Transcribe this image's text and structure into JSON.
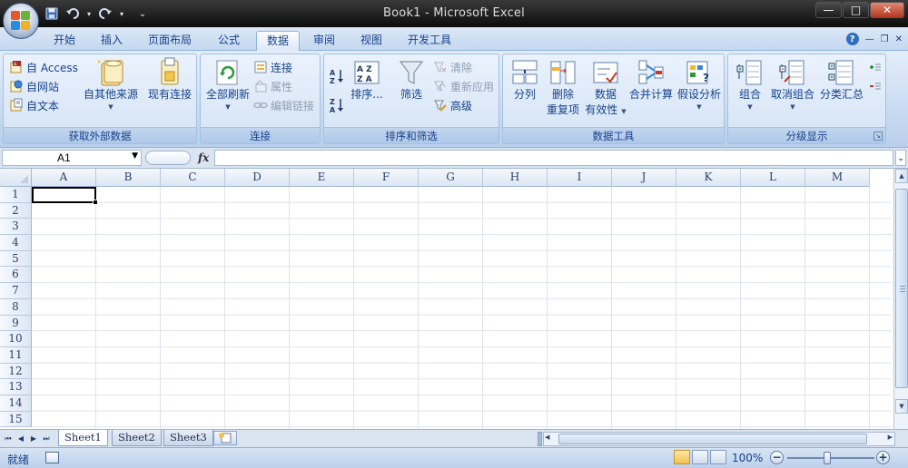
{
  "window": {
    "title": "Book1 - Microsoft Excel",
    "controls": {
      "minimize": "—",
      "maximize": "□",
      "close": "✕"
    }
  },
  "quick_access": [
    "save-icon",
    "undo-icon",
    "redo-icon",
    "customize-icon"
  ],
  "ribbon_tabs": [
    "开始",
    "插入",
    "页面布局",
    "公式",
    "数据",
    "审阅",
    "视图",
    "开发工具"
  ],
  "active_tab": "数据",
  "groups": {
    "external": {
      "label": "获取外部数据",
      "access": "自 Access",
      "web": "自网站",
      "text": "自文本",
      "other_sources": "自其他来源",
      "existing": "现有连接"
    },
    "connections": {
      "label": "连接",
      "refresh_all": "全部刷新",
      "connections": "连接",
      "properties": "属性",
      "edit_links": "编辑链接"
    },
    "sort_filter": {
      "label": "排序和筛选",
      "sort": "排序...",
      "filter": "筛选",
      "clear": "清除",
      "reapply": "重新应用",
      "advanced": "高级",
      "az": "A Z",
      "za": "Z A"
    },
    "data_tools": {
      "label": "数据工具",
      "text_to_columns": "分列",
      "remove_dup_1": "删除",
      "remove_dup_2": "重复项",
      "validation_1": "数据",
      "validation_2": "有效性",
      "consolidate": "合并计算",
      "what_if": "假设分析"
    },
    "outline": {
      "label": "分级显示",
      "group": "组合",
      "ungroup": "取消组合",
      "subtotal": "分类汇总"
    }
  },
  "formula_bar": {
    "name_box": "A1",
    "fx": "fx",
    "formula": ""
  },
  "columns": [
    "A",
    "B",
    "C",
    "D",
    "E",
    "F",
    "G",
    "H",
    "I",
    "J",
    "K",
    "L",
    "M"
  ],
  "rows": [
    "1",
    "2",
    "3",
    "4",
    "5",
    "6",
    "7",
    "8",
    "9",
    "10",
    "11",
    "12",
    "13",
    "14",
    "15"
  ],
  "sheets": [
    "Sheet1",
    "Sheet2",
    "Sheet3"
  ],
  "active_sheet": "Sheet1",
  "status": {
    "ready": "就绪",
    "zoom": "100%",
    "zoom_level": 100
  },
  "colors": {
    "accent": "#15428b",
    "ribbon": "#c6d9f1",
    "selected_view": "#f5c14e"
  }
}
